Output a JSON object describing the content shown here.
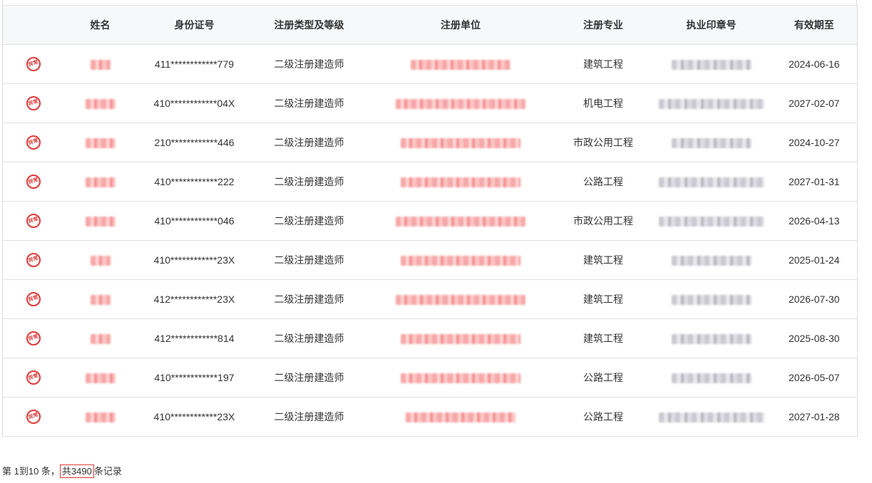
{
  "table": {
    "columns": [
      "",
      "姓名",
      "身份证号",
      "注册类型及等级",
      "注册单位",
      "注册专业",
      "执业印章号",
      "有效期至"
    ],
    "rows": [
      {
        "id": "411************779",
        "type": "二级注册建造师",
        "major": "建筑工程",
        "expiry": "2024-06-16"
      },
      {
        "id": "410************04X",
        "type": "二级注册建造师",
        "major": "机电工程",
        "expiry": "2027-02-07"
      },
      {
        "id": "210************446",
        "type": "二级注册建造师",
        "major": "市政公用工程",
        "expiry": "2024-10-27"
      },
      {
        "id": "410************222",
        "type": "二级注册建造师",
        "major": "公路工程",
        "expiry": "2027-01-31"
      },
      {
        "id": "410************046",
        "type": "二级注册建造师",
        "major": "市政公用工程",
        "expiry": "2026-04-13"
      },
      {
        "id": "410************23X",
        "type": "二级注册建造师",
        "major": "建筑工程",
        "expiry": "2025-01-24"
      },
      {
        "id": "412************23X",
        "type": "二级注册建造师",
        "major": "建筑工程",
        "expiry": "2026-07-30"
      },
      {
        "id": "412************814",
        "type": "二级注册建造师",
        "major": "建筑工程",
        "expiry": "2025-08-30"
      },
      {
        "id": "410************197",
        "type": "二级注册建造师",
        "major": "公路工程",
        "expiry": "2026-05-07"
      },
      {
        "id": "410************23X",
        "type": "二级注册建造师",
        "major": "公路工程",
        "expiry": "2027-01-28"
      }
    ],
    "row_icon": "abnormal-stamp-icon",
    "stamp_text": "异常"
  },
  "pagination": {
    "prefix": "第 1到10 条，",
    "total_text": "共3490",
    "suffix": "条记录"
  },
  "colors": {
    "stamp": "#e03a3a",
    "header_bg": "#f7f8fa",
    "border": "#e2e2e2"
  }
}
